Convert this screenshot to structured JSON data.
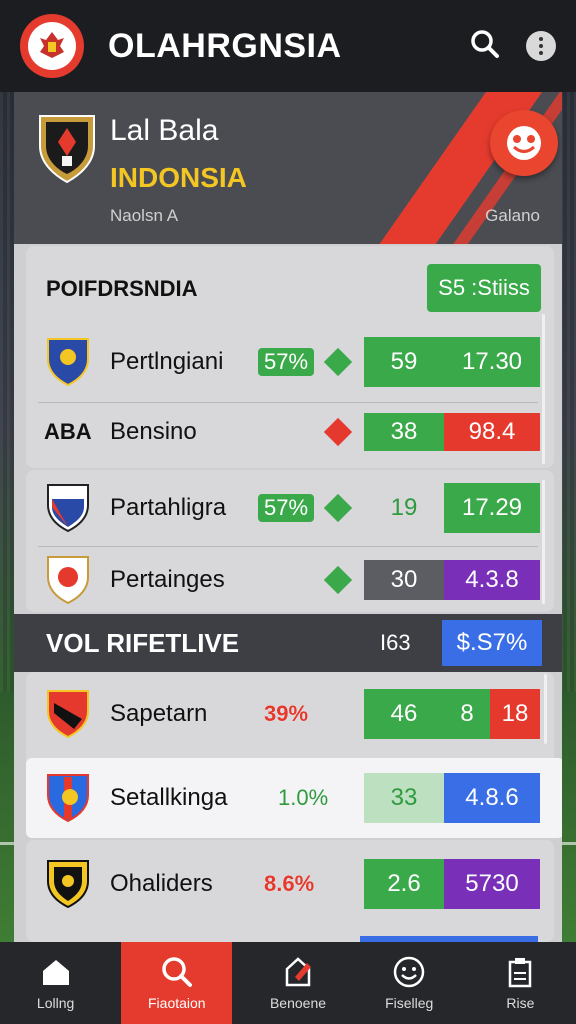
{
  "header": {
    "title": "OLAHRGNSIA",
    "search_icon": "search-icon",
    "menu_icon": "more-vertical-icon"
  },
  "hero": {
    "line1": "Lal Bala",
    "line2": "INDONSIA",
    "sub_left": "Naolsn A",
    "sub_right": "Galano",
    "accent": "#e53b2e",
    "highlight": "#f3c623"
  },
  "section1": {
    "title": "POIFDRSNDIA",
    "pill": "S5 :Stiiss",
    "rows": [
      {
        "name": "Pertlngiani",
        "pct": "57%",
        "trend": "up",
        "val1": "59",
        "val2": "17.30",
        "val2_color": "#3aa94a"
      },
      {
        "name": "Bensino",
        "label": "ABA",
        "pct": "",
        "trend": "down",
        "val1": "38",
        "val2": "98.4",
        "val2_color": "#e5392d"
      }
    ]
  },
  "section2": {
    "rows": [
      {
        "name": "Partahligra",
        "pct": "57%",
        "trend": "up",
        "val1": "19",
        "val2": "17.29",
        "val2_color": "#3aa94a"
      },
      {
        "name": "Pertainges",
        "pct": "",
        "trend": "up",
        "val1": "30",
        "val2": "4.3.8",
        "val2_color": "#7a2fb8"
      }
    ]
  },
  "live_band": {
    "title": "VOL RIFETLIVE",
    "count": "I63",
    "value": "$.S7%"
  },
  "section3": {
    "rows": [
      {
        "name": "Sapetarn",
        "pct": "39%",
        "val1": "46",
        "val2a": "8",
        "val2b": "18"
      },
      {
        "name": "Setallkinga",
        "pct": "1.0%",
        "val1": "33",
        "val2": "4.8.6"
      },
      {
        "name": "Ohaliders",
        "pct": "8.6%",
        "val1": "2.6",
        "val2": "5730"
      }
    ]
  },
  "nav": {
    "items": [
      {
        "label": "Lollng",
        "icon": "home-icon"
      },
      {
        "label": "Fiaotaion",
        "icon": "search-icon"
      },
      {
        "label": "Benoene",
        "icon": "edit-icon"
      },
      {
        "label": "Fiselleg",
        "icon": "smile-icon"
      },
      {
        "label": "Rise",
        "icon": "clipboard-icon"
      }
    ]
  }
}
